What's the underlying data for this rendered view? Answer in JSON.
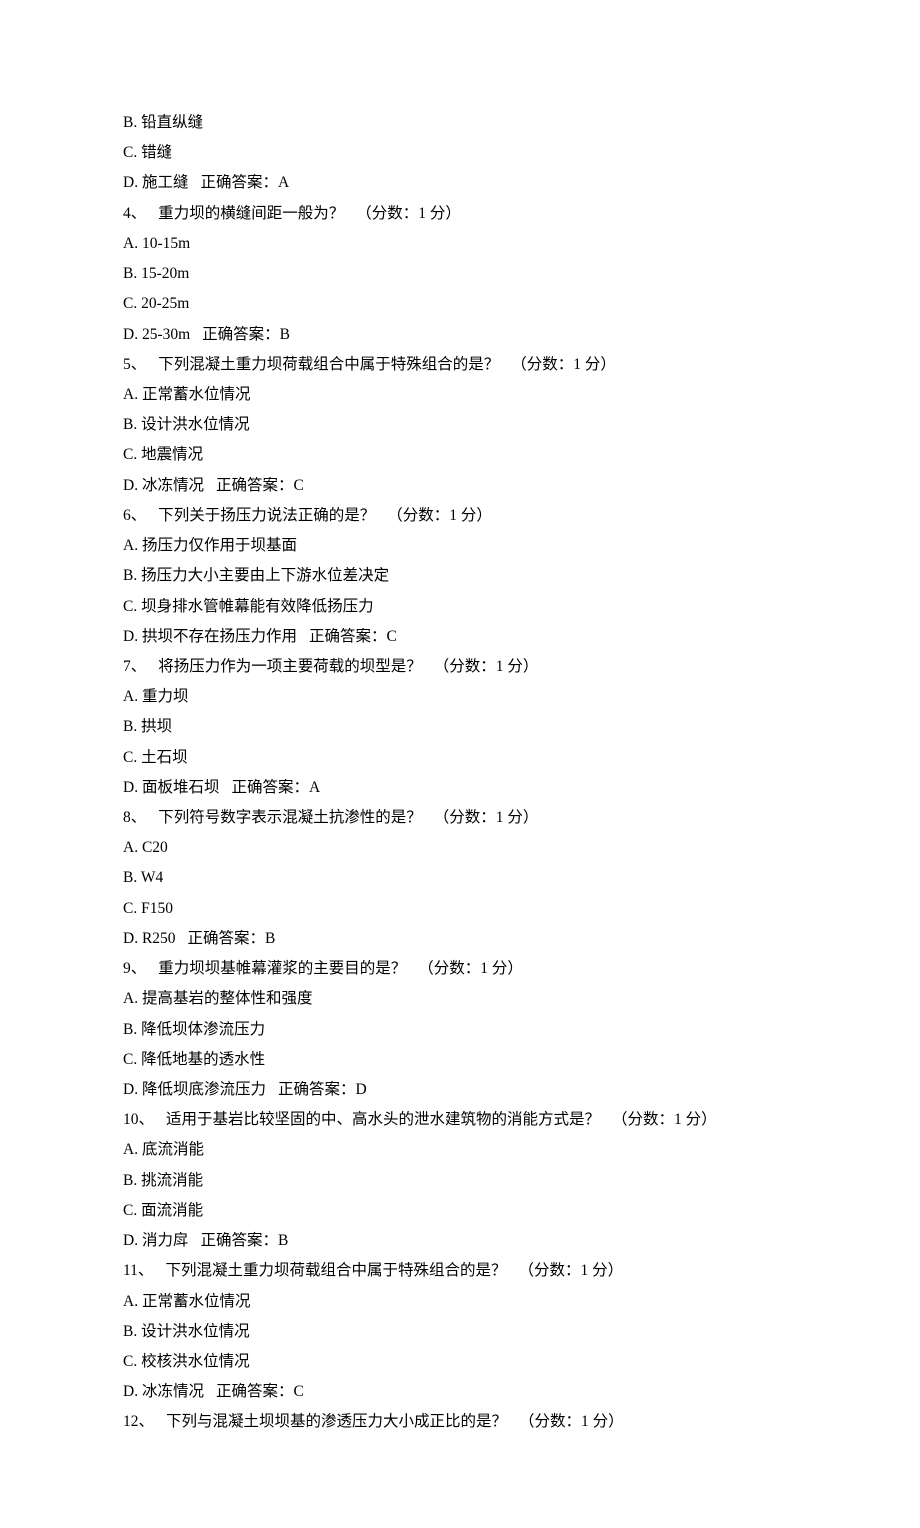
{
  "orphan_options": [
    {
      "letter": "B",
      "text": "铅直纵缝"
    },
    {
      "letter": "C",
      "text": "错缝"
    },
    {
      "letter": "D",
      "text": "施工缝",
      "answer": "正确答案：A"
    }
  ],
  "questions": [
    {
      "num": "4、",
      "text": "重力坝的横缝间距一般为？",
      "score": "（分数：1 分）",
      "options": [
        {
          "letter": "A",
          "text": "10-15m"
        },
        {
          "letter": "B",
          "text": "15-20m"
        },
        {
          "letter": "C",
          "text": "20-25m"
        },
        {
          "letter": "D",
          "text": "25-30m",
          "answer": "正确答案：B"
        }
      ]
    },
    {
      "num": "5、",
      "text": "下列混凝土重力坝荷载组合中属于特殊组合的是？",
      "score": "（分数：1 分）",
      "options": [
        {
          "letter": "A",
          "text": "正常蓄水位情况"
        },
        {
          "letter": "B",
          "text": "设计洪水位情况"
        },
        {
          "letter": "C",
          "text": "地震情况"
        },
        {
          "letter": "D",
          "text": "冰冻情况",
          "answer": "正确答案：C"
        }
      ]
    },
    {
      "num": "6、",
      "text": "下列关于扬压力说法正确的是？",
      "score": "（分数：1 分）",
      "options": [
        {
          "letter": "A",
          "text": "扬压力仅作用于坝基面"
        },
        {
          "letter": "B",
          "text": "扬压力大小主要由上下游水位差决定"
        },
        {
          "letter": "C",
          "text": "坝身排水管帷幕能有效降低扬压力"
        },
        {
          "letter": "D",
          "text": "拱坝不存在扬压力作用",
          "answer": "正确答案：C"
        }
      ]
    },
    {
      "num": "7、",
      "text": "将扬压力作为一项主要荷载的坝型是？",
      "score": "（分数：1 分）",
      "options": [
        {
          "letter": "A",
          "text": "重力坝"
        },
        {
          "letter": "B",
          "text": "拱坝"
        },
        {
          "letter": "C",
          "text": "土石坝"
        },
        {
          "letter": "D",
          "text": "面板堆石坝",
          "answer": "正确答案：A"
        }
      ]
    },
    {
      "num": "8、",
      "text": "下列符号数字表示混凝土抗渗性的是？",
      "score": "（分数：1 分）",
      "options": [
        {
          "letter": "A",
          "text": "C20"
        },
        {
          "letter": "B",
          "text": "W4"
        },
        {
          "letter": "C",
          "text": "F150"
        },
        {
          "letter": "D",
          "text": "R250",
          "answer": "正确答案：B"
        }
      ]
    },
    {
      "num": "9、",
      "text": "重力坝坝基帷幕灌浆的主要目的是？",
      "score": "（分数：1 分）",
      "options": [
        {
          "letter": "A",
          "text": "提高基岩的整体性和强度"
        },
        {
          "letter": "B",
          "text": "降低坝体渗流压力"
        },
        {
          "letter": "C",
          "text": "降低地基的透水性"
        },
        {
          "letter": "D",
          "text": "降低坝底渗流压力",
          "answer": "正确答案：D"
        }
      ]
    },
    {
      "num": "10、",
      "text": "适用于基岩比较坚固的中、高水头的泄水建筑物的消能方式是？",
      "score": "（分数：1 分）",
      "options": [
        {
          "letter": "A",
          "text": "底流消能"
        },
        {
          "letter": "B",
          "text": "挑流消能"
        },
        {
          "letter": "C",
          "text": "面流消能"
        },
        {
          "letter": "D",
          "text": "消力戽",
          "answer": "正确答案：B"
        }
      ]
    },
    {
      "num": "11、",
      "text": "下列混凝土重力坝荷载组合中属于特殊组合的是？",
      "score": "（分数：1 分）",
      "options": [
        {
          "letter": "A",
          "text": "正常蓄水位情况"
        },
        {
          "letter": "B",
          "text": "设计洪水位情况"
        },
        {
          "letter": "C",
          "text": "校核洪水位情况"
        },
        {
          "letter": "D",
          "text": "冰冻情况",
          "answer": "正确答案：C"
        }
      ]
    },
    {
      "num": "12、",
      "text": "下列与混凝土坝坝基的渗透压力大小成正比的是？",
      "score": "（分数：1 分）",
      "options": []
    }
  ]
}
